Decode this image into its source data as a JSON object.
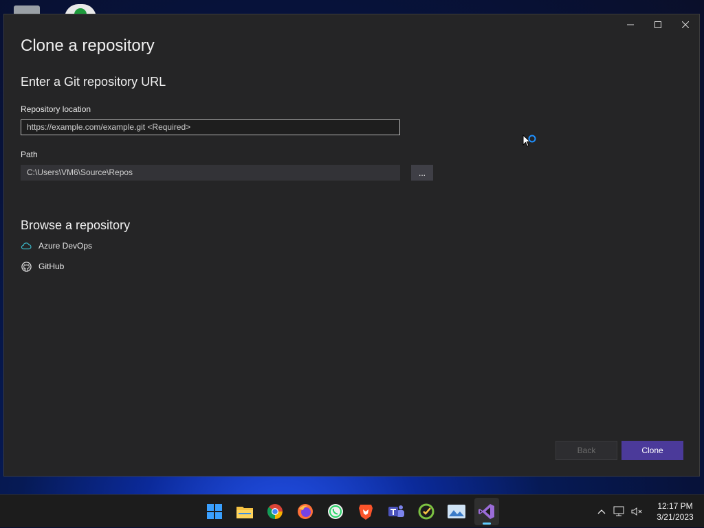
{
  "window": {
    "title": "Clone a repository",
    "controls": [
      "minimize",
      "maximize",
      "close"
    ]
  },
  "url_section": {
    "heading": "Enter a Git repository URL",
    "repo_label": "Repository location",
    "repo_placeholder": "https://example.com/example.git <Required>",
    "path_label": "Path",
    "path_value": "C:\\Users\\VM6\\Source\\Repos",
    "browse_label": "..."
  },
  "browse_section": {
    "heading": "Browse a repository",
    "items": [
      {
        "label": "Azure DevOps",
        "icon": "cloud-icon"
      },
      {
        "label": "GitHub",
        "icon": "github-icon"
      }
    ]
  },
  "buttons": {
    "back": "Back",
    "clone": "Clone"
  },
  "colors": {
    "window_bg": "#252526",
    "accent": "#4b3a9a",
    "azure_icon": "#3ab8c8"
  },
  "taskbar": {
    "apps": [
      "start",
      "file-explorer",
      "chrome",
      "firefox",
      "whatsapp",
      "brave",
      "teams",
      "app-green",
      "photos",
      "visual-studio"
    ],
    "time": "12:17 PM",
    "date": "3/21/2023"
  }
}
